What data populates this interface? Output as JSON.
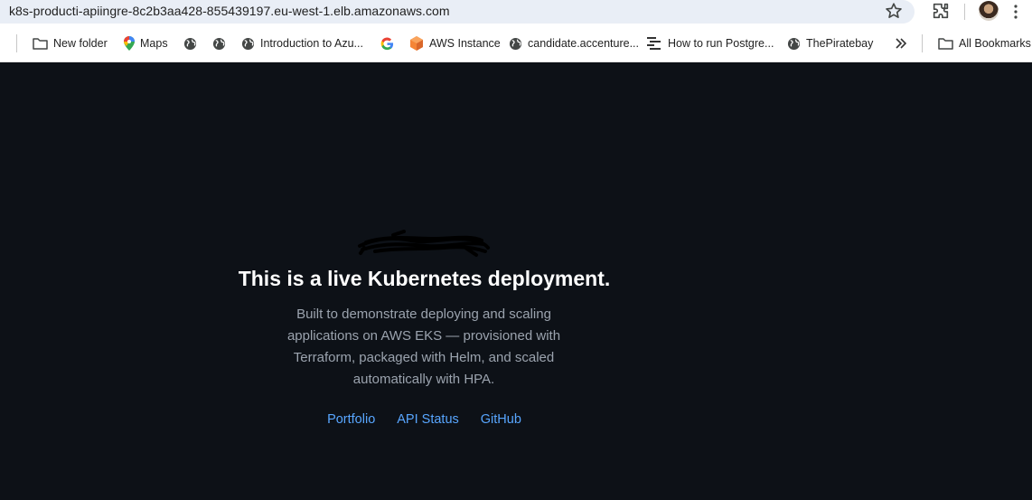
{
  "browser": {
    "url": "k8s-producti-apiingre-8c2b3aa428-855439197.eu-west-1.elb.amazonaws.com",
    "icons": [
      "star-icon",
      "extensions-icon",
      "profile-avatar",
      "menu-icon"
    ]
  },
  "bookmarks": {
    "items": [
      {
        "label": "",
        "icon": "apps-grid-icon"
      },
      {
        "label": "New folder",
        "icon": "folder-icon"
      },
      {
        "label": "Maps",
        "icon": "maps-pin-icon"
      },
      {
        "label": "",
        "icon": "globe-icon"
      },
      {
        "label": "",
        "icon": "globe-icon"
      },
      {
        "label": "Introduction to Azu...",
        "icon": "globe-icon"
      },
      {
        "label": "",
        "icon": "google-icon"
      },
      {
        "label": "AWS Instance",
        "icon": "aws-cube-icon"
      },
      {
        "label": "candidate.accenture...",
        "icon": "globe-icon"
      },
      {
        "label": "How to run Postgre...",
        "icon": "list-icon"
      },
      {
        "label": "ThePiratebay",
        "icon": "globe-icon"
      }
    ],
    "overflow_icon": "chevron-double-right-icon",
    "all_bookmarks": "All Bookmarks"
  },
  "page": {
    "headline": "This is a live Kubernetes deployment.",
    "description": "Built to demonstrate deploying and scaling applications on AWS EKS — provisioned with Terraform, packaged with Helm, and scaled automatically with HPA.",
    "links": {
      "portfolio": "Portfolio",
      "api_status": "API Status",
      "github": "GitHub"
    },
    "colors": {
      "background": "#0d1117",
      "headline": "#ffffff",
      "body": "#9ba3ae",
      "link": "#58a6ff"
    }
  }
}
